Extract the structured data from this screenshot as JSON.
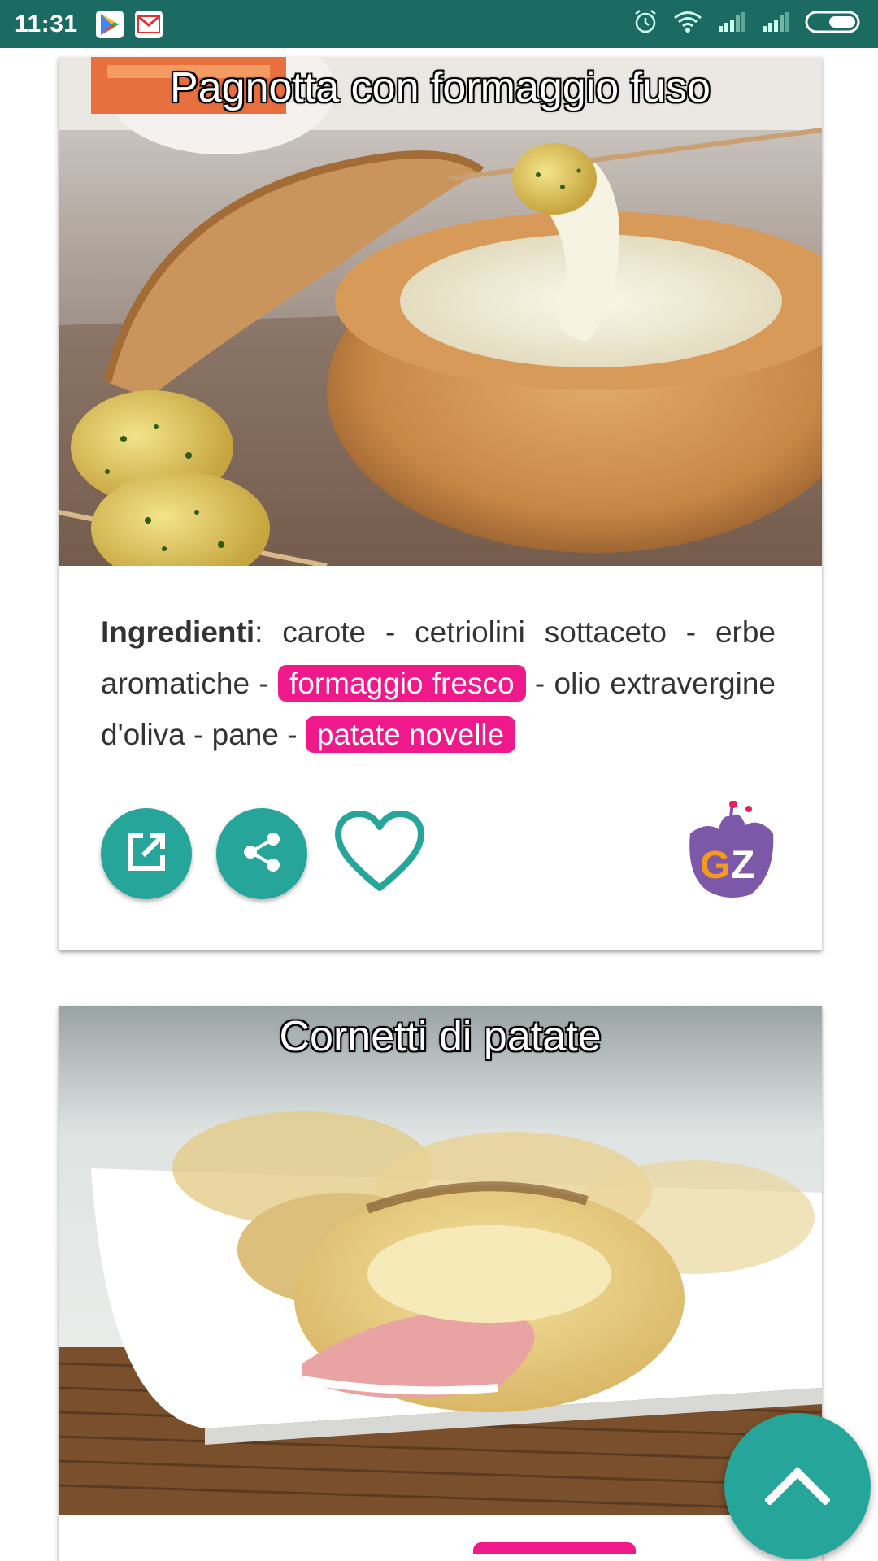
{
  "status_bar": {
    "time": "11:31",
    "left_icons": [
      "play-store-icon",
      "gmail-icon"
    ],
    "right_icons": [
      "alarm-icon",
      "wifi-icon",
      "signal-icon",
      "signal-icon",
      "battery-icon"
    ]
  },
  "recipes": [
    {
      "title": "Pagnotta con formaggio fuso",
      "ingredients_label": "Ingredienti",
      "ingredients_segments": [
        {
          "text": "carote - cetriolini sottaceto - erbe aromatiche - ",
          "highlight": false
        },
        {
          "text": "formaggio fresco",
          "highlight": true
        },
        {
          "text": " - olio extravergine d'oliva - pane - ",
          "highlight": false
        },
        {
          "text": "patate novelle",
          "highlight": true
        }
      ],
      "actions": [
        "open-external-icon",
        "share-icon",
        "heart-icon"
      ],
      "source_logo": "GZ"
    },
    {
      "title": "Cornetti di patate"
    }
  ],
  "colors": {
    "status_bar": "#1b6b62",
    "accent": "#26a69a",
    "highlight": "#f0198c"
  }
}
